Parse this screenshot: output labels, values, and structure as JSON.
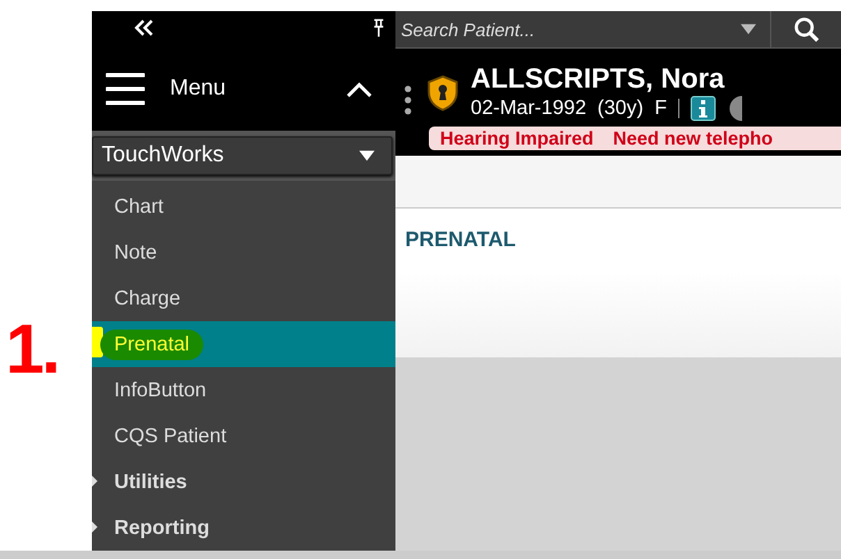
{
  "annotation": {
    "label": "1."
  },
  "sidebar": {
    "menu_title": "Menu",
    "expanded": true,
    "app": "TouchWorks",
    "items": [
      {
        "label": "Chart",
        "selected": false,
        "kind": "link"
      },
      {
        "label": "Note",
        "selected": false,
        "kind": "link"
      },
      {
        "label": "Charge",
        "selected": false,
        "kind": "link"
      },
      {
        "label": "Prenatal",
        "selected": true,
        "kind": "link"
      },
      {
        "label": "InfoButton",
        "selected": false,
        "kind": "link"
      },
      {
        "label": "CQS Patient",
        "selected": false,
        "kind": "link"
      },
      {
        "label": "Utilities",
        "selected": false,
        "kind": "group"
      },
      {
        "label": "Reporting",
        "selected": false,
        "kind": "group"
      }
    ]
  },
  "search": {
    "placeholder": "Search Patient..."
  },
  "patient": {
    "name": "ALLSCRIPTS, Nora",
    "dob": "02-Mar-1992",
    "age": "(30y)",
    "sex": "F",
    "alerts": [
      "Hearing Impaired",
      "Need new telepho"
    ]
  },
  "page": {
    "title": "PRENATAL"
  }
}
